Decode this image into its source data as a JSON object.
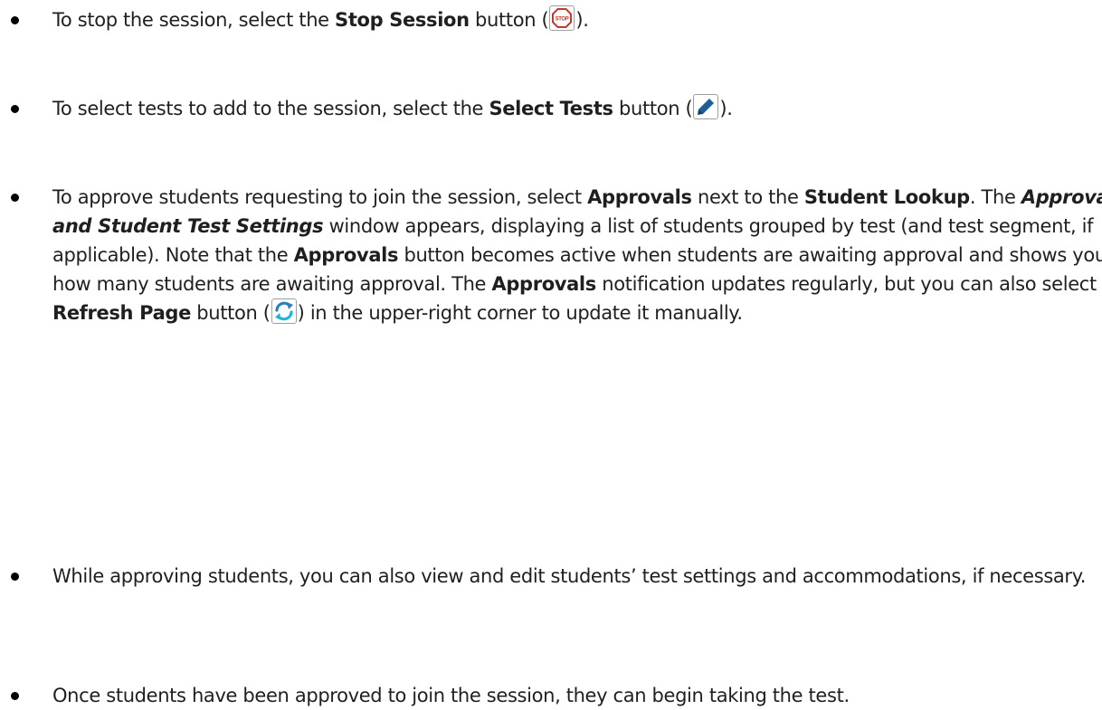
{
  "items": [
    {
      "pre": "To stop the session, select the ",
      "bold": "Stop Session",
      "mid": " button (",
      "icon": "stop-icon",
      "post": ")."
    },
    {
      "pre": "To select tests to add to the session, select the ",
      "bold": "Select Tests",
      "mid": " button (",
      "icon": "pencil-icon",
      "post": ")."
    },
    {
      "t1": "To approve students requesting to join the session, select ",
      "b1": "Approvals",
      "t2": " next to the ",
      "b2": "Student Lookup",
      "t3": ". The ",
      "bi1": "Approvals and Student Test Settings",
      "t4": " window appears, displaying a list of students grouped by test (and test segment, if applicable). Note that the ",
      "b3": "Approvals",
      "t5": " button becomes active when students are awaiting approval and shows you how many students are awaiting approval. The ",
      "b4": "Approvals",
      "t6": " notification updates regularly, but you can also select the ",
      "b5": "Refresh Page",
      "t7": " button (",
      "icon": "refresh-icon",
      "t8": ") in the upper-right corner to update it manually."
    },
    {
      "text": "While approving students, you can also view and edit students’ test settings and accommodations, if necessary."
    },
    {
      "text": "Once students have been approved to join the session, they can begin taking the test."
    }
  ],
  "colors": {
    "stop_red": "#c0392b",
    "pencil_blue": "#1a5e9a",
    "refresh_blue": "#2a7fc1",
    "refresh_cyan": "#22b5d8"
  }
}
